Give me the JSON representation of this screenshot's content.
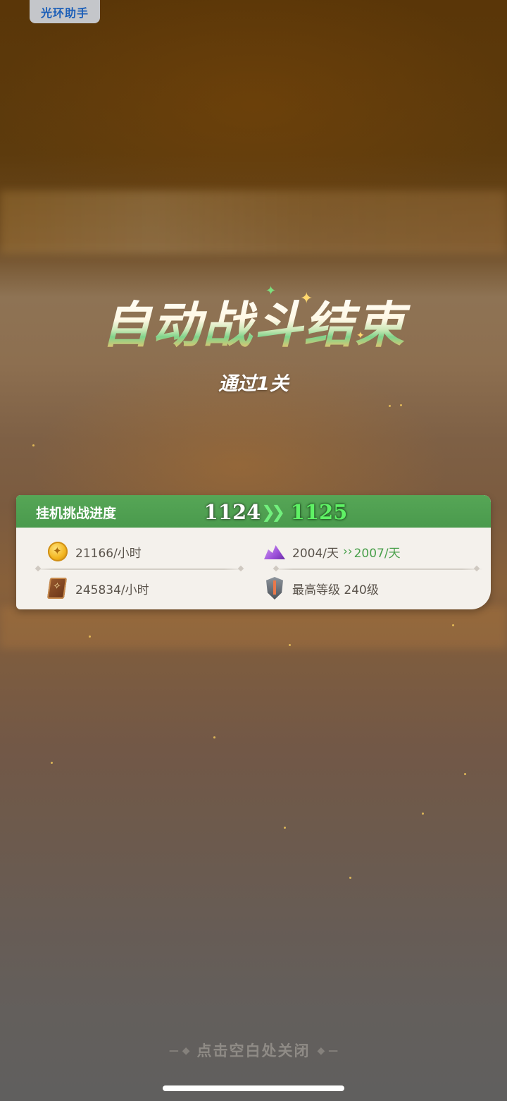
{
  "assistant_badge": "光环助手",
  "title": "自动战斗结束",
  "subtitle": "通过1关",
  "progress_panel": {
    "title": "挂机挑战进度",
    "stage_from": "1124",
    "stage_to": "1125",
    "rewards": {
      "gold_rate": "21166/小时",
      "crystal_rate_old": "2004/天",
      "crystal_rate_new": "2007/天",
      "exp_rate": "245834/小时",
      "max_level": "最高等级 240级"
    }
  },
  "close_hint": "点击空白处关闭",
  "colors": {
    "header_green": "#4f9f50",
    "stage_new_green": "#5ff265",
    "panel_bg": "#f4f1ec",
    "badge_text": "#1c5fb8"
  },
  "icons": {
    "gold": "gold-coin-icon",
    "crystal": "purple-crystal-icon",
    "exp": "exp-book-icon",
    "level": "shield-sword-icon",
    "arrow": "double-chevron-right-icon"
  }
}
